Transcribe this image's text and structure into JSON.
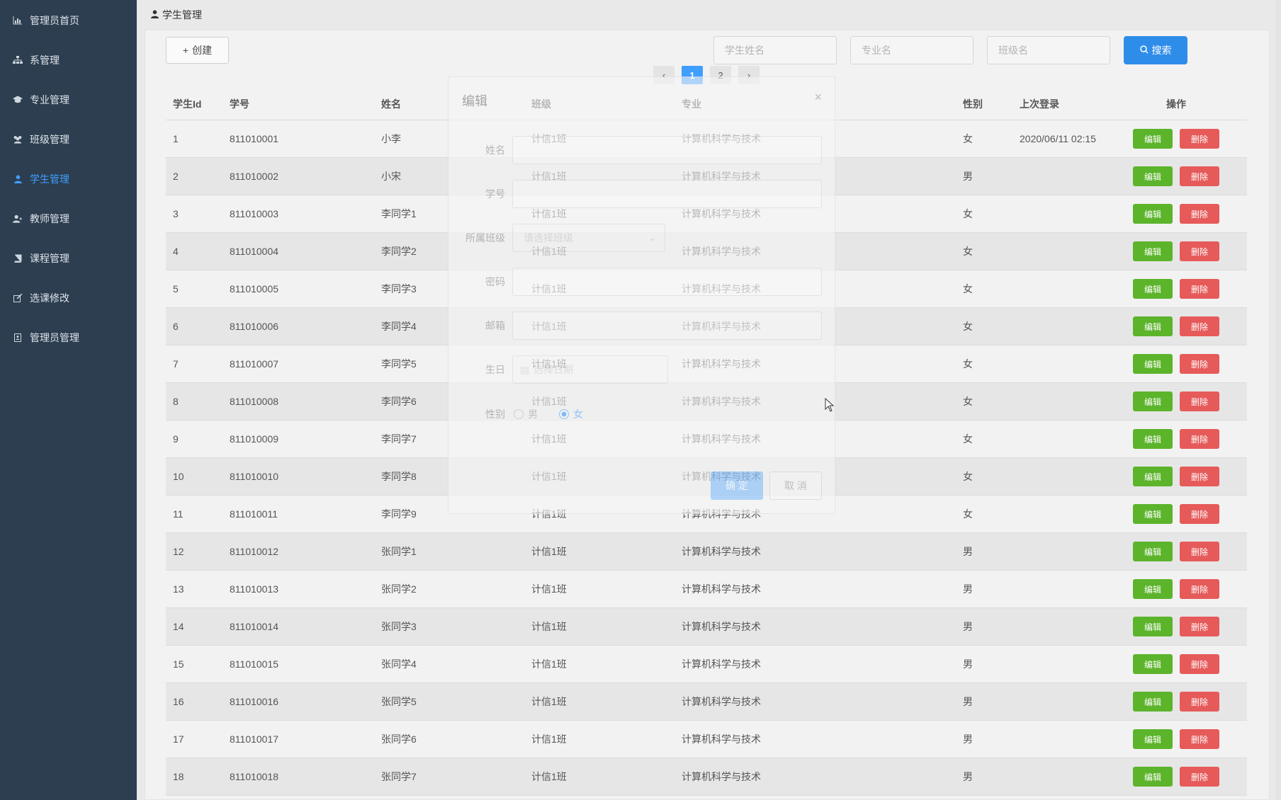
{
  "sidebar": {
    "items": [
      {
        "label": "管理员首页",
        "icon": "bar-chart-icon",
        "active": false
      },
      {
        "label": "系管理",
        "icon": "sitemap-icon",
        "active": false
      },
      {
        "label": "专业管理",
        "icon": "graduation-cap-icon",
        "active": false
      },
      {
        "label": "班级管理",
        "icon": "users-icon",
        "active": false
      },
      {
        "label": "学生管理",
        "icon": "user-icon",
        "active": true
      },
      {
        "label": "教师管理",
        "icon": "user-plus-icon",
        "active": false
      },
      {
        "label": "课程管理",
        "icon": "book-icon",
        "active": false
      },
      {
        "label": "选课修改",
        "icon": "edit-icon",
        "active": false
      },
      {
        "label": "管理员管理",
        "icon": "id-card-icon",
        "active": false
      }
    ],
    "background": "#2c3e50",
    "active_color": "#409eff"
  },
  "breadcrumb": {
    "label": "学生管理",
    "icon": "user-icon"
  },
  "toolbar": {
    "create_label": "创建",
    "search_label": "搜索",
    "placeholders": {
      "student_name": "学生姓名",
      "major_name": "专业名",
      "class_name": "班级名"
    }
  },
  "pagination": {
    "prev": "‹",
    "next": "›",
    "pages": [
      "1",
      "2"
    ],
    "current": "1"
  },
  "table": {
    "columns": [
      "学生Id",
      "学号",
      "姓名",
      "班级",
      "专业",
      "性别",
      "上次登录",
      "操作"
    ],
    "edit_label": "编辑",
    "delete_label": "删除",
    "rows": [
      {
        "id": "1",
        "no": "811010001",
        "name": "小李",
        "class": "计信1班",
        "major": "计算机科学与技术",
        "gender": "女",
        "last_login": "2020/06/11 02:15"
      },
      {
        "id": "2",
        "no": "811010002",
        "name": "小宋",
        "class": "计信1班",
        "major": "计算机科学与技术",
        "gender": "男",
        "last_login": ""
      },
      {
        "id": "3",
        "no": "811010003",
        "name": "李同学1",
        "class": "计信1班",
        "major": "计算机科学与技术",
        "gender": "女",
        "last_login": ""
      },
      {
        "id": "4",
        "no": "811010004",
        "name": "李同学2",
        "class": "计信1班",
        "major": "计算机科学与技术",
        "gender": "女",
        "last_login": ""
      },
      {
        "id": "5",
        "no": "811010005",
        "name": "李同学3",
        "class": "计信1班",
        "major": "计算机科学与技术",
        "gender": "女",
        "last_login": ""
      },
      {
        "id": "6",
        "no": "811010006",
        "name": "李同学4",
        "class": "计信1班",
        "major": "计算机科学与技术",
        "gender": "女",
        "last_login": ""
      },
      {
        "id": "7",
        "no": "811010007",
        "name": "李同学5",
        "class": "计信1班",
        "major": "计算机科学与技术",
        "gender": "女",
        "last_login": ""
      },
      {
        "id": "8",
        "no": "811010008",
        "name": "李同学6",
        "class": "计信1班",
        "major": "计算机科学与技术",
        "gender": "女",
        "last_login": ""
      },
      {
        "id": "9",
        "no": "811010009",
        "name": "李同学7",
        "class": "计信1班",
        "major": "计算机科学与技术",
        "gender": "女",
        "last_login": ""
      },
      {
        "id": "10",
        "no": "811010010",
        "name": "李同学8",
        "class": "计信1班",
        "major": "计算机科学与技术",
        "gender": "女",
        "last_login": ""
      },
      {
        "id": "11",
        "no": "811010011",
        "name": "李同学9",
        "class": "计信1班",
        "major": "计算机科学与技术",
        "gender": "女",
        "last_login": ""
      },
      {
        "id": "12",
        "no": "811010012",
        "name": "张同学1",
        "class": "计信1班",
        "major": "计算机科学与技术",
        "gender": "男",
        "last_login": ""
      },
      {
        "id": "13",
        "no": "811010013",
        "name": "张同学2",
        "class": "计信1班",
        "major": "计算机科学与技术",
        "gender": "男",
        "last_login": ""
      },
      {
        "id": "14",
        "no": "811010014",
        "name": "张同学3",
        "class": "计信1班",
        "major": "计算机科学与技术",
        "gender": "男",
        "last_login": ""
      },
      {
        "id": "15",
        "no": "811010015",
        "name": "张同学4",
        "class": "计信1班",
        "major": "计算机科学与技术",
        "gender": "男",
        "last_login": ""
      },
      {
        "id": "16",
        "no": "811010016",
        "name": "张同学5",
        "class": "计信1班",
        "major": "计算机科学与技术",
        "gender": "男",
        "last_login": ""
      },
      {
        "id": "17",
        "no": "811010017",
        "name": "张同学6",
        "class": "计信1班",
        "major": "计算机科学与技术",
        "gender": "男",
        "last_login": ""
      },
      {
        "id": "18",
        "no": "811010018",
        "name": "张同学7",
        "class": "计信1班",
        "major": "计算机科学与技术",
        "gender": "男",
        "last_login": ""
      }
    ]
  },
  "modal": {
    "title": "编辑",
    "fields": {
      "name": "姓名",
      "number": "学号",
      "class": "所属班级",
      "class_placeholder": "请选择班级",
      "password": "密码",
      "email": "邮箱",
      "birthday": "生日",
      "birthday_placeholder": "选择日期",
      "gender": "性别",
      "male": "男",
      "female": "女",
      "selected_gender": "女"
    },
    "confirm": "确 定",
    "cancel": "取 消"
  },
  "colors": {
    "primary": "#409eff",
    "success": "#5cb42b",
    "danger": "#e65a5a"
  }
}
